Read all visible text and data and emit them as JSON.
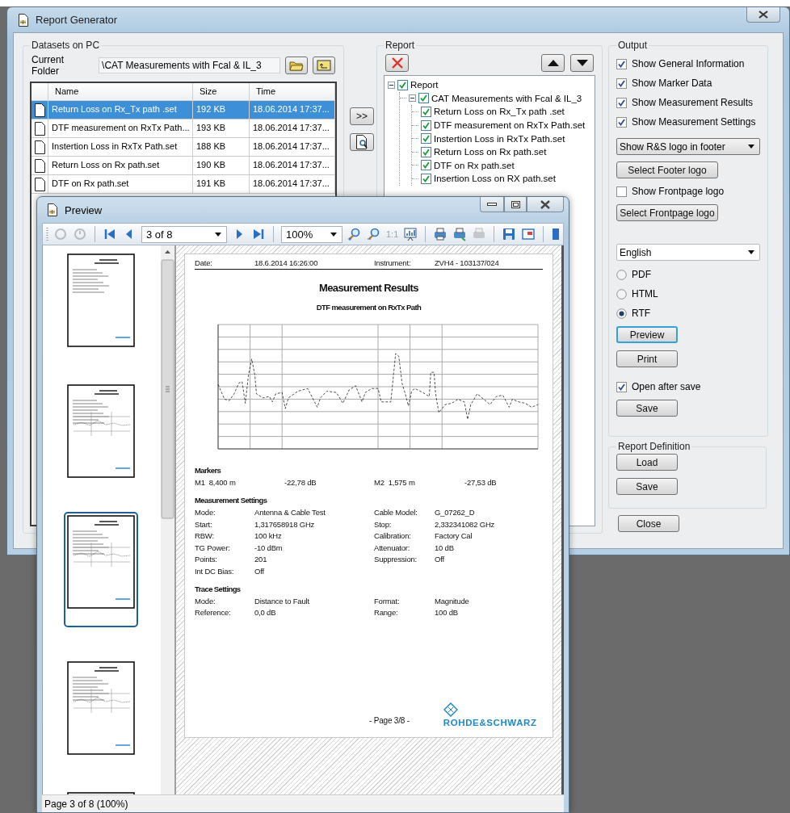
{
  "main_window": {
    "title": "Report Generator",
    "datasets": {
      "title": "Datasets on PC",
      "folder_label": "Current Folder",
      "folder_value": "\\CAT Measurements with Fcal & IL_3",
      "columns": [
        "Name",
        "Size",
        "Time"
      ],
      "rows": [
        {
          "name": "Return Loss on Rx_Tx path .set",
          "size": "192 KB",
          "time": "18.06.2014 17:37...",
          "selected": true
        },
        {
          "name": "DTF measurement on RxTx Path...",
          "size": "193 KB",
          "time": "18.06.2014 17:37...",
          "selected": false
        },
        {
          "name": "Instertion Loss in RxTx Path.set",
          "size": "188 KB",
          "time": "18.06.2014 17:37...",
          "selected": false
        },
        {
          "name": "Return Loss on Rx path.set",
          "size": "190 KB",
          "time": "18.06.2014 17:37...",
          "selected": false
        },
        {
          "name": "DTF on Rx path.set",
          "size": "191 KB",
          "time": "18.06.2014 17:37...",
          "selected": false
        }
      ]
    },
    "add_button": ">>",
    "report": {
      "title": "Report",
      "tree": [
        {
          "label": "Report",
          "checked": true,
          "expanded": true,
          "children": [
            {
              "label": "CAT Measurements with Fcal & IL_3",
              "checked": true,
              "expanded": true,
              "children": [
                {
                  "label": "Return Loss on Rx_Tx path .set",
                  "checked": true
                },
                {
                  "label": "DTF measurement on RxTx Path.set",
                  "checked": true
                },
                {
                  "label": "Instertion Loss in RxTx Path.set",
                  "checked": true
                },
                {
                  "label": "Return Loss on Rx path.set",
                  "checked": true
                },
                {
                  "label": "DTF on Rx path.set",
                  "checked": true
                },
                {
                  "label": "Insertion Loss on RX path.set",
                  "checked": true
                }
              ]
            }
          ]
        }
      ]
    },
    "output": {
      "title": "Output",
      "options": [
        {
          "label": "Show General Information",
          "checked": true
        },
        {
          "label": "Show Marker Data",
          "checked": true
        },
        {
          "label": "Show Measurement Results",
          "checked": true
        },
        {
          "label": "Show Measurement Settings",
          "checked": true
        }
      ],
      "logo_dropdown": "Show R&S logo in footer",
      "select_footer_button": "Select Footer logo",
      "frontpage_logo": {
        "label": "Show Frontpage logo",
        "checked": false
      },
      "select_frontpage_button": "Select Frontpage logo",
      "language": "English",
      "formats": [
        {
          "label": "PDF",
          "selected": false
        },
        {
          "label": "HTML",
          "selected": false
        },
        {
          "label": "RTF",
          "selected": true
        }
      ],
      "preview_button": {
        "label": "Preview",
        "default": true
      },
      "print_button": {
        "label": "Print",
        "default": false
      },
      "open_after_save": {
        "label": "Open after save",
        "checked": true
      },
      "save_button": "Save"
    },
    "report_definition": {
      "title": "Report Definition",
      "buttons": [
        "Load",
        "Save"
      ]
    },
    "close_button": "Close"
  },
  "preview_window": {
    "title": "Preview",
    "page_select": "3 of 8",
    "zoom_select": "100%",
    "actual_size": "1:1",
    "thumbnails": [
      {
        "selected": false
      },
      {
        "selected": false
      },
      {
        "selected": true
      },
      {
        "selected": false
      },
      {
        "selected": false
      }
    ],
    "page": {
      "header": [
        {
          "label": "Date:",
          "value": "18.6.2014 16:26:00"
        },
        {
          "label": "Instrument:",
          "value": "ZVH4 - 103137/024"
        }
      ],
      "title": "Measurement Results",
      "subtitle": "DTF measurement on RxTx Path",
      "markers_heading": "Markers",
      "markers": [
        {
          "name": "M1",
          "position": "8,400 m",
          "value": "-22,78 dB"
        },
        {
          "name": "M2",
          "position": "1,575 m",
          "value": "-27,53 dB"
        }
      ],
      "sections": [
        {
          "heading": "Measurement Settings",
          "rows": [
            {
              "label": "Mode:",
              "value": "Antenna & Cable Test",
              "label_2": "Cable Model:",
              "value_2": "G_07262_D"
            },
            {
              "label": "Start:",
              "value": "1,317658918 GHz",
              "label_2": "Stop:",
              "value_2": "2,332341082 GHz"
            },
            {
              "label": "RBW:",
              "value": "100 kHz",
              "label_2": "Calibration:",
              "value_2": "Factory Cal"
            },
            {
              "label": "TG Power:",
              "value": "-10 dBm",
              "label_2": "Attenuator:",
              "value_2": "10 dB"
            },
            {
              "label": "Points:",
              "value": "201",
              "label_2": "Suppression:",
              "value_2": "Off"
            },
            {
              "label": "Int DC Bias:",
              "value": "Off"
            }
          ]
        },
        {
          "heading": "Trace Settings",
          "rows": [
            {
              "label": "Mode:",
              "value": "Distance to Fault",
              "label_2": "Format:",
              "value_2": "Magnitude"
            },
            {
              "label": "Reference:",
              "value": "0,0 dB",
              "label_2": "Range:",
              "value_2": "100 dB"
            }
          ]
        }
      ],
      "footer": "- Page 3/8 -",
      "logo": "ROHDE&SCHWARZ"
    },
    "status": "Page 3 of 8 (100%)"
  }
}
